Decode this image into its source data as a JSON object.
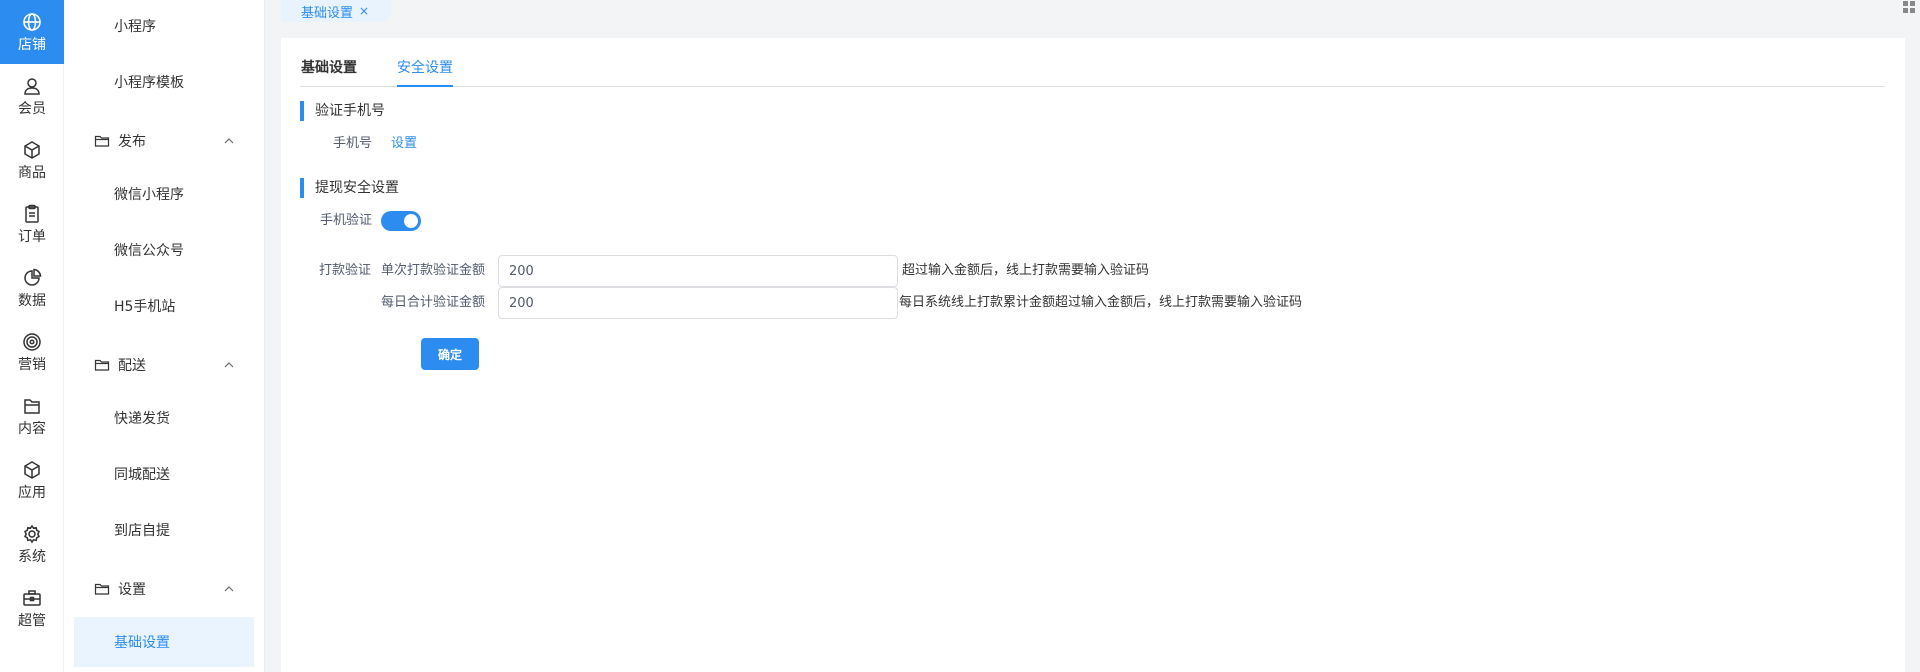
{
  "rail": {
    "items": [
      {
        "label": "店铺",
        "icon": "store-icon"
      },
      {
        "label": "会员",
        "icon": "user-icon"
      },
      {
        "label": "商品",
        "icon": "box-icon"
      },
      {
        "label": "订单",
        "icon": "clipboard-icon"
      },
      {
        "label": "数据",
        "icon": "pie-chart-icon"
      },
      {
        "label": "营销",
        "icon": "target-icon"
      },
      {
        "label": "内容",
        "icon": "document-icon"
      },
      {
        "label": "应用",
        "icon": "cube-icon"
      },
      {
        "label": "系统",
        "icon": "gear-icon"
      },
      {
        "label": "超管",
        "icon": "toolbox-icon"
      }
    ],
    "active_index": 0
  },
  "menu": {
    "top_items": [
      "小程序",
      "小程序模板"
    ],
    "groups": [
      {
        "label": "发布",
        "items": [
          "微信小程序",
          "微信公众号",
          "H5手机站"
        ]
      },
      {
        "label": "配送",
        "items": [
          "快递发货",
          "同城配送",
          "到店自提"
        ]
      },
      {
        "label": "设置",
        "items": [
          "基础设置"
        ]
      }
    ],
    "active_item": "基础设置"
  },
  "page_tab": {
    "label": "基础设置",
    "close": "×"
  },
  "tabs": [
    "基础设置",
    "安全设置"
  ],
  "active_tab": "安全设置",
  "verify_phone": {
    "title": "验证手机号",
    "field_label": "手机号",
    "action": "设置"
  },
  "withdraw": {
    "title": "提现安全设置",
    "switch_label": "手机验证",
    "switch_on": true,
    "payment_label": "打款验证",
    "single_label": "单次打款验证金额",
    "single_value": "200",
    "single_hint": "超过输入金额后，线上打款需要输入验证码",
    "daily_label": "每日合计验证金额",
    "daily_value": "200",
    "daily_hint": "每日系统线上打款累计金额超过输入金额后，线上打款需要输入验证码"
  },
  "confirm_button": "确定",
  "colors": {
    "accent": "#2d8cf0",
    "active_bg": "#eaf4fe"
  }
}
